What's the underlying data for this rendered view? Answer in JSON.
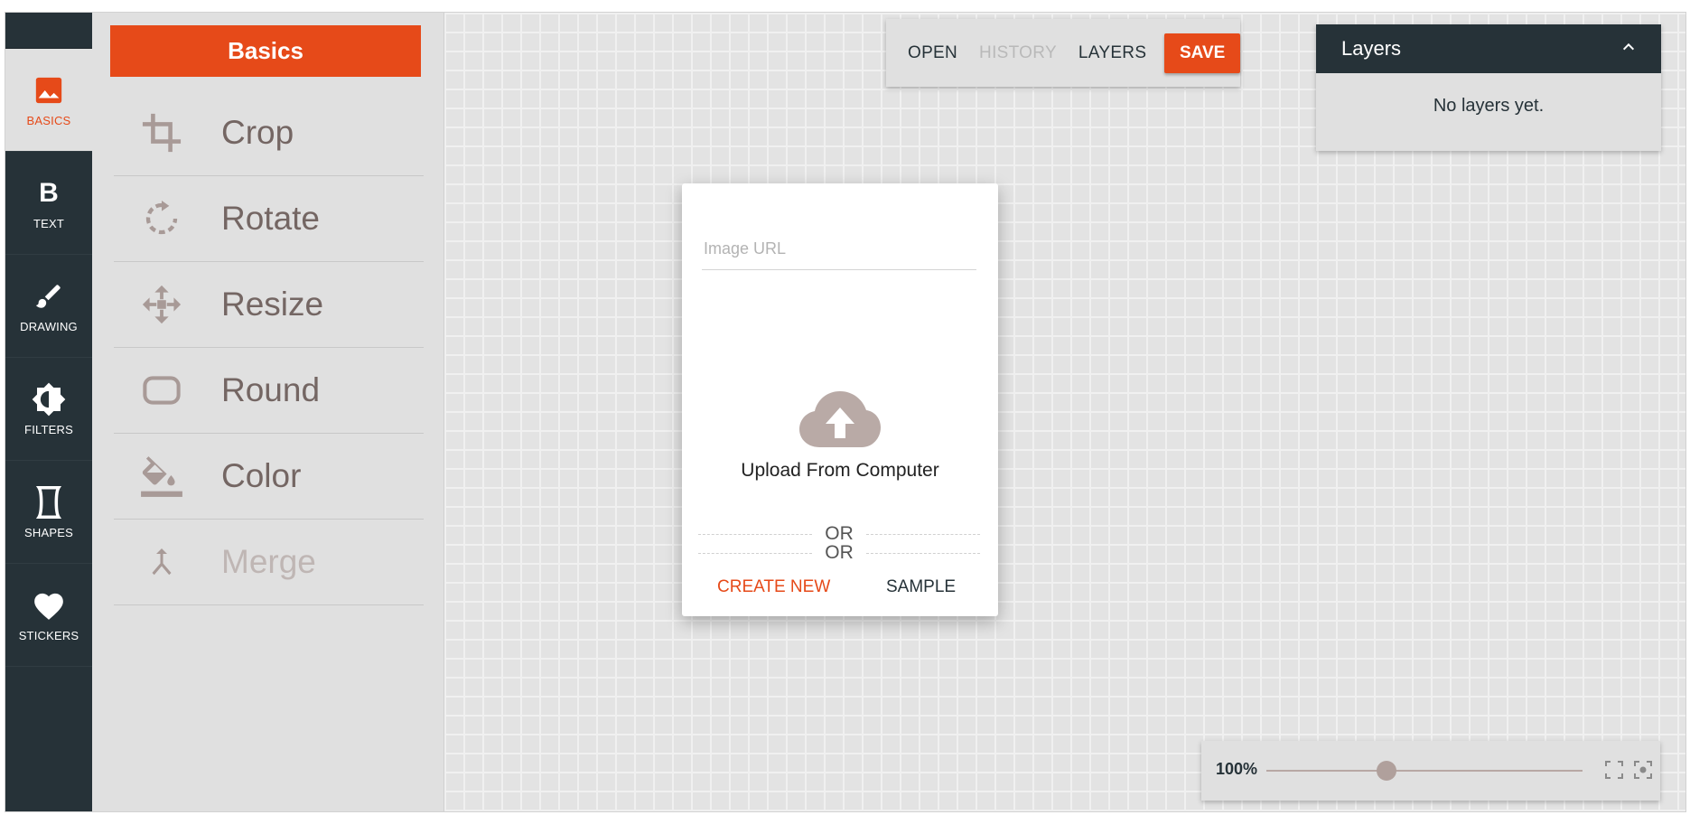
{
  "rail": {
    "items": [
      {
        "label": "BASICS",
        "icon": "image-icon",
        "active": true
      },
      {
        "label": "TEXT",
        "icon": "bold-icon"
      },
      {
        "label": "DRAWING",
        "icon": "brush-icon"
      },
      {
        "label": "FILTERS",
        "icon": "brightness-icon"
      },
      {
        "label": "SHAPES",
        "icon": "shape-icon"
      },
      {
        "label": "STICKERS",
        "icon": "heart-icon"
      }
    ]
  },
  "panel": {
    "title": "Basics",
    "tools": [
      {
        "label": "Crop",
        "icon": "crop-icon"
      },
      {
        "label": "Rotate",
        "icon": "rotate-icon"
      },
      {
        "label": "Resize",
        "icon": "move-icon"
      },
      {
        "label": "Round",
        "icon": "rounded-rect-icon"
      },
      {
        "label": "Color",
        "icon": "paint-bucket-icon"
      },
      {
        "label": "Merge",
        "icon": "merge-icon",
        "disabled": true
      }
    ]
  },
  "toolbar": {
    "open": "OPEN",
    "history": "HISTORY",
    "layers": "LAYERS",
    "save": "SAVE"
  },
  "layers_panel": {
    "title": "Layers",
    "empty_text": "No layers yet."
  },
  "dialog": {
    "url_placeholder": "Image URL",
    "or": "OR",
    "upload_label": "Upload From Computer",
    "create_new": "CREATE NEW",
    "sample": "SAMPLE"
  },
  "zoom": {
    "value_label": "100%",
    "level": 0.38
  },
  "colors": {
    "accent": "#e64a19",
    "dark": "#263238",
    "icon": "#a89a97"
  }
}
